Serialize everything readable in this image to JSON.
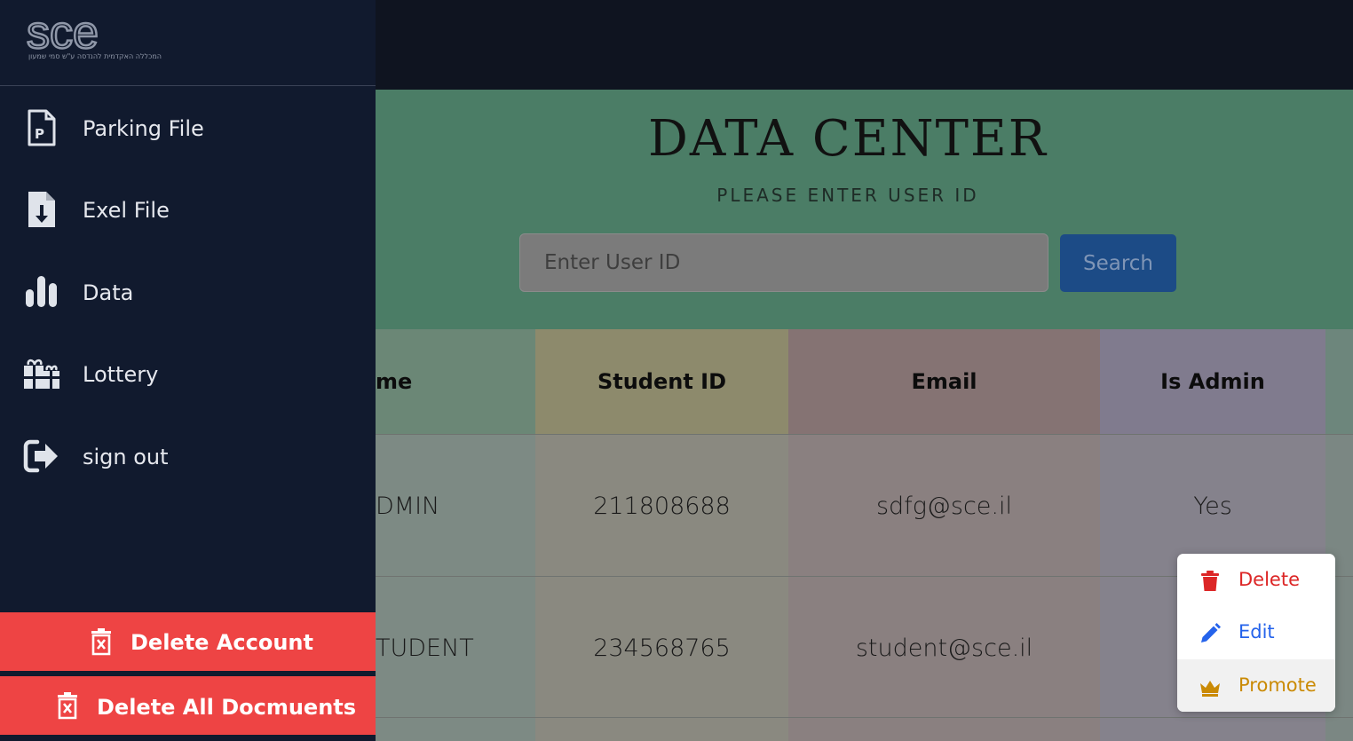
{
  "sidebar": {
    "logo": {
      "text": "sce",
      "tagline": "המכללה האקדמית להנדסה ע\"ש סמי שמעון"
    },
    "items": [
      {
        "label": "Parking File",
        "icon": "parking-file-icon"
      },
      {
        "label": "Exel File",
        "icon": "file-download-icon"
      },
      {
        "label": "Data",
        "icon": "bar-chart-icon"
      },
      {
        "label": "Lottery",
        "icon": "gifts-icon"
      },
      {
        "label": "sign out",
        "icon": "sign-out-icon"
      }
    ],
    "delete_account_label": "Delete Account",
    "delete_docs_label": "Delete All Docmuents"
  },
  "hero": {
    "title": "DATA CENTER",
    "subtitle": "PLEASE ENTER USER ID",
    "search_placeholder": "Enter User ID",
    "search_button": "Search"
  },
  "table": {
    "headers": [
      "me",
      "Student ID",
      "Email",
      "Is Admin"
    ],
    "rows": [
      [
        "DMIN",
        "211808688",
        "sdfg@sce.il",
        "Yes"
      ],
      [
        "TUDENT",
        "234568765",
        "student@sce.il",
        ""
      ]
    ]
  },
  "context_menu": {
    "items": [
      {
        "label": "Delete",
        "icon": "trash-icon",
        "color": "#dc2626"
      },
      {
        "label": "Edit",
        "icon": "pencil-icon",
        "color": "#2563eb"
      },
      {
        "label": "Promote",
        "icon": "crown-icon",
        "color": "#ca8a04"
      }
    ]
  },
  "colors": {
    "sidebar_bg": "#111a2e",
    "danger": "#ee4444",
    "hero_bg": "#4b7d66",
    "search_button": "#1c4b86"
  }
}
